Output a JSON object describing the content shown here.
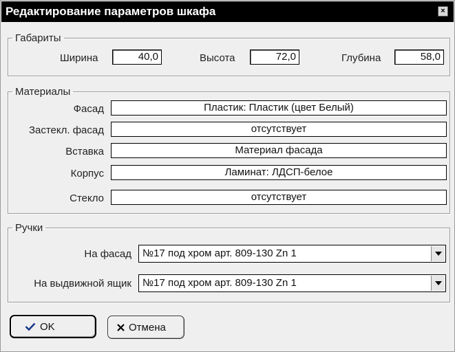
{
  "window": {
    "title": "Редактирование параметров шкафа",
    "close_icon": "×"
  },
  "dimensions": {
    "legend": "Габариты",
    "width_label": "Ширина",
    "width_value": "40,0",
    "height_label": "Высота",
    "height_value": "72,0",
    "depth_label": "Глубина",
    "depth_value": "58,0"
  },
  "materials": {
    "legend": "Материалы",
    "items": [
      {
        "label": "Фасад",
        "value": "Пластик: Пластик (цвет Белый)"
      },
      {
        "label": "Застекл. фасад",
        "value": "отсутствует"
      },
      {
        "label": "Вставка",
        "value": "Материал фасада"
      },
      {
        "label": "Корпус",
        "value": "Ламинат: ЛДСП-белое"
      },
      {
        "label": "Стекло",
        "value": "отсутствует"
      }
    ]
  },
  "handles": {
    "legend": "Ручки",
    "facade_label": "На фасад",
    "facade_value": "№17 под хром арт. 809-130 Zn 1",
    "drawer_label": "На выдвижной ящик",
    "drawer_value": "№17 под хром арт. 809-130 Zn 1"
  },
  "buttons": {
    "ok_label": "OK",
    "cancel_label": "Отмена"
  }
}
